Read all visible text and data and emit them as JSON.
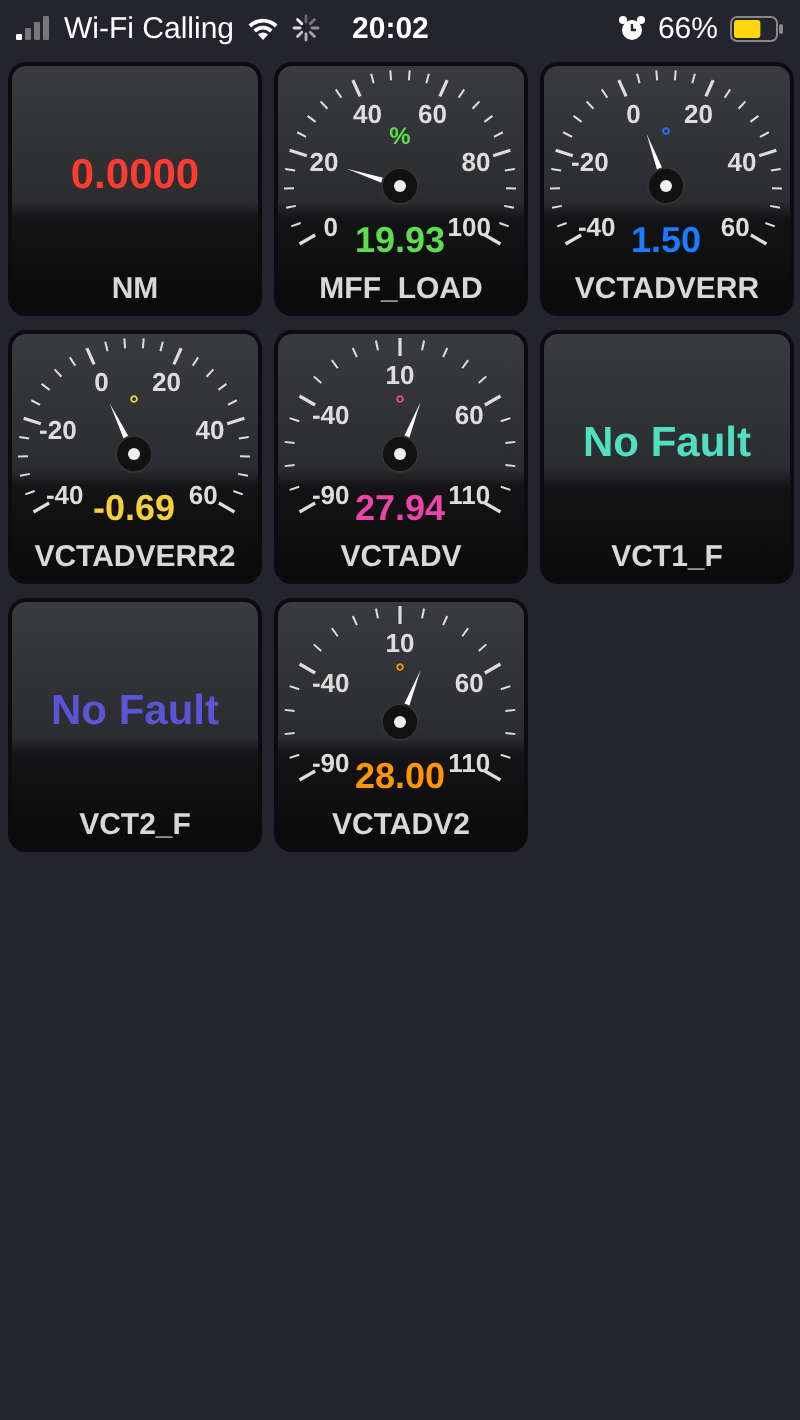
{
  "status_bar": {
    "carrier": "Wi-Fi Calling",
    "time": "20:02",
    "battery": "66%"
  },
  "tiles": [
    {
      "kind": "digital",
      "name": "NM",
      "value": "0.0000",
      "color": "#ff3b30"
    },
    {
      "kind": "gauge",
      "name": "MFF_LOAD",
      "value": "19.93",
      "unit": "%",
      "color": "#5ddc4f",
      "scale": [
        "0",
        "20",
        "40",
        "60",
        "80",
        "100"
      ]
    },
    {
      "kind": "gauge",
      "name": "VCTADVERR",
      "value": "1.50",
      "unit": "°",
      "color": "#1a7cff",
      "scale": [
        "-40",
        "-20",
        "0",
        "20",
        "40",
        "60"
      ]
    },
    {
      "kind": "gauge",
      "name": "VCTADVERR2",
      "value": "-0.69",
      "unit": "°",
      "color": "#f5d03a",
      "scale": [
        "-40",
        "-20",
        "0",
        "20",
        "40",
        "60"
      ]
    },
    {
      "kind": "gauge",
      "name": "VCTADV",
      "value": "27.94",
      "unit": "°",
      "color": "#ee44aa",
      "scale": [
        "-90",
        "-40",
        "10",
        "60",
        "110"
      ]
    },
    {
      "kind": "digital",
      "name": "VCT1_F",
      "value": "No Fault",
      "color": "#4fe0c0"
    },
    {
      "kind": "digital",
      "name": "VCT2_F",
      "value": "No Fault",
      "color": "#5a55d6"
    },
    {
      "kind": "gauge",
      "name": "VCTADV2",
      "value": "28.00",
      "unit": "°",
      "color": "#ff9500",
      "scale": [
        "-90",
        "-40",
        "10",
        "60",
        "110"
      ]
    }
  ]
}
